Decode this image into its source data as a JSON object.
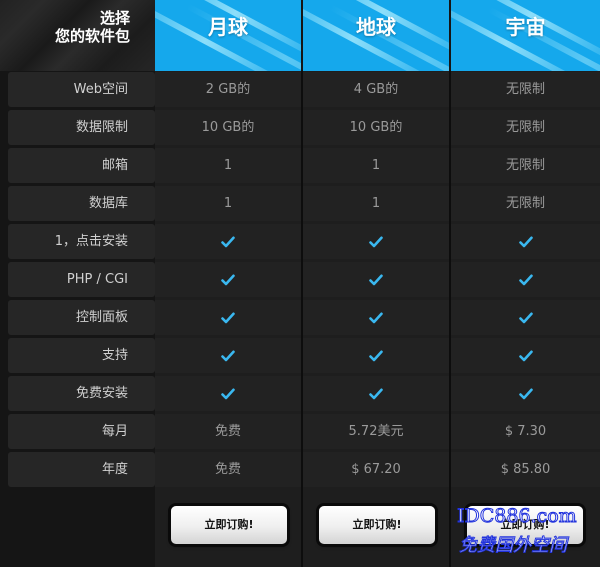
{
  "title": {
    "line1": "选择",
    "line2": "您的软件包"
  },
  "plans": [
    {
      "name": "月球",
      "button_label": "立即订购!"
    },
    {
      "name": "地球",
      "button_label": "立即订购!"
    },
    {
      "name": "宇宙",
      "button_label": "立即订购!"
    }
  ],
  "rows": [
    {
      "label": "Web空间",
      "values": [
        "2 GB的",
        "4 GB的",
        "无限制"
      ]
    },
    {
      "label": "数据限制",
      "values": [
        "10 GB的",
        "10 GB的",
        "无限制"
      ]
    },
    {
      "label": "邮箱",
      "values": [
        "1",
        "1",
        "无限制"
      ]
    },
    {
      "label": "数据库",
      "values": [
        "1",
        "1",
        "无限制"
      ]
    },
    {
      "label": "1，点击安装",
      "values": [
        "check",
        "check",
        "check"
      ]
    },
    {
      "label": "PHP / CGI",
      "values": [
        "check",
        "check",
        "check"
      ]
    },
    {
      "label": "控制面板",
      "values": [
        "check",
        "check",
        "check"
      ]
    },
    {
      "label": "支持",
      "values": [
        "check",
        "check",
        "check"
      ]
    },
    {
      "label": "免费安装",
      "values": [
        "check",
        "check",
        "check"
      ]
    },
    {
      "label": "每月",
      "values": [
        "免费",
        "5.72美元",
        "$ 7.30"
      ]
    },
    {
      "label": "年度",
      "values": [
        "免费",
        "$ 67.20",
        "$ 85.80"
      ]
    }
  ],
  "icons": {
    "included": "checkmark-icon"
  },
  "colors": {
    "header_blue": "#15a8ec",
    "check_blue": "#3ab8f0"
  },
  "watermark": {
    "line1": "IDC886.com",
    "line2": "免费国外空间"
  }
}
